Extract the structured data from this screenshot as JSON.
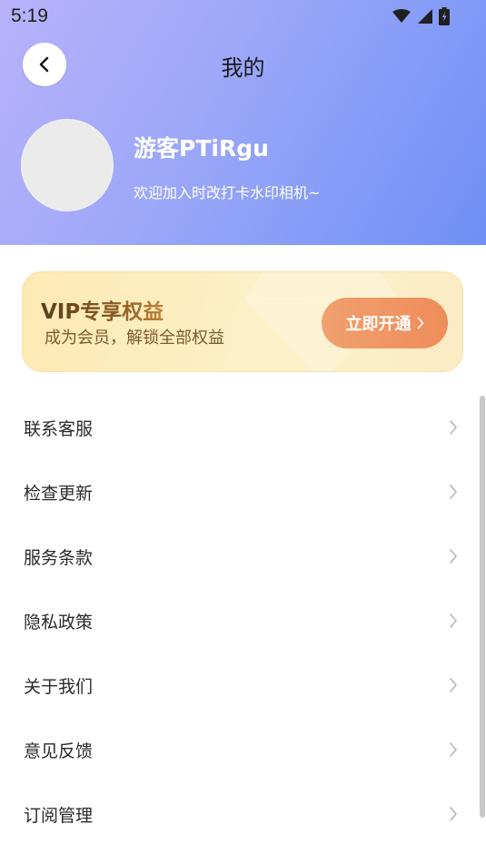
{
  "status_bar": {
    "time": "5:19"
  },
  "header": {
    "title": "我的",
    "back_icon": "chevron-left-icon",
    "username": "游客PTiRgu",
    "welcome": "欢迎加入时改打卡水印相机~"
  },
  "vip": {
    "title": "VIP专享权益",
    "subtitle": "成为会员，解锁全部权益",
    "button_label": "立即开通",
    "button_icon": "chevron-right-icon"
  },
  "menu": {
    "items": [
      {
        "label": "联系客服"
      },
      {
        "label": "检查更新"
      },
      {
        "label": "服务条款"
      },
      {
        "label": "隐私政策"
      },
      {
        "label": "关于我们"
      },
      {
        "label": "意见反馈"
      },
      {
        "label": "订阅管理"
      }
    ]
  },
  "colors": {
    "header_gradient_start": "#b9b2fb",
    "header_gradient_end": "#6f8ff6",
    "vip_button": "#ee8d5a",
    "vip_card": "#fde9b3"
  }
}
